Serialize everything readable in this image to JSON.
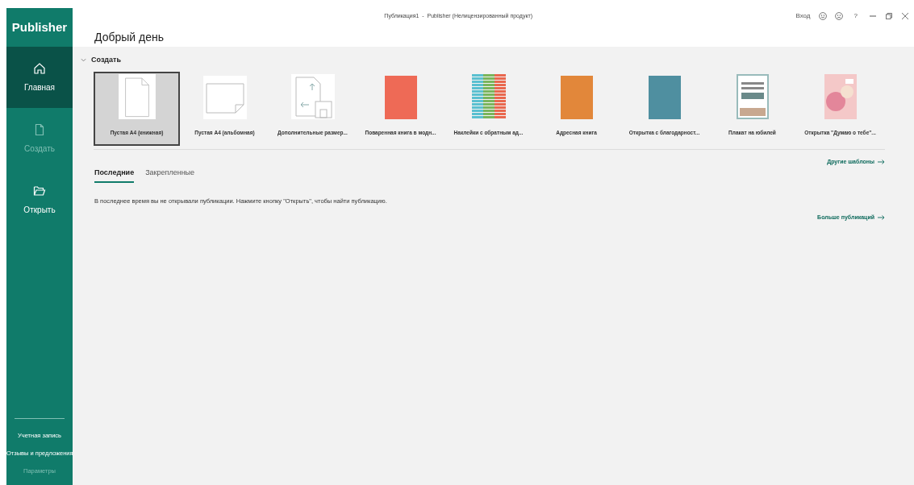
{
  "window": {
    "title": "Публикация1  -  Publisher (Нелицензированный продукт)",
    "sign_in": "Вход",
    "help": "?"
  },
  "app_name": "Publisher",
  "sidebar": {
    "items": [
      {
        "label": "Главная",
        "kind": "home",
        "selected": true,
        "disabled": false
      },
      {
        "label": "Создать",
        "kind": "new",
        "selected": false,
        "disabled": true
      },
      {
        "label": "Открыть",
        "kind": "open",
        "selected": false,
        "disabled": false
      }
    ],
    "bottom_items": [
      {
        "label": "Учетная запись",
        "disabled": false
      },
      {
        "label": "Отзывы и предложения",
        "disabled": false
      },
      {
        "label": "Параметры",
        "disabled": true
      }
    ]
  },
  "greeting": "Добрый день",
  "create_section": {
    "title": "Создать",
    "expanded": true,
    "templates": [
      {
        "kind": "portrait",
        "label": "Пустая А4 (книжная)",
        "selected": true
      },
      {
        "kind": "landscape",
        "label": "Пустая А4 (альбомная)",
        "selected": false
      },
      {
        "kind": "sizes",
        "label": "Дополнительные размер...",
        "selected": false
      },
      {
        "kind": "cover",
        "label": "Поваренная книга в модн...",
        "color": "#ee6a56",
        "selected": false
      },
      {
        "kind": "stripes",
        "label": "Наклейки с обратным ад...",
        "selected": false
      },
      {
        "kind": "cover",
        "label": "Адресная книга",
        "color": "#e2873a",
        "selected": false
      },
      {
        "kind": "cover",
        "label": "Открытка с благодарност...",
        "color": "#4f8fa0",
        "selected": false
      },
      {
        "kind": "poster",
        "label": "Плакат на юбилей",
        "selected": false
      },
      {
        "kind": "flower",
        "label": "Открытка \"Думаю о тебе\"...",
        "selected": false
      }
    ],
    "more_link": "Другие шаблоны"
  },
  "tabs": [
    {
      "label": "Последние",
      "selected": true
    },
    {
      "label": "Закрепленные",
      "selected": false
    }
  ],
  "empty_message": "В последнее время вы не открывали публикации. Нажмите кнопку \"Открыть\", чтобы найти публикацию.",
  "more_publications": "Больше публикаций"
}
